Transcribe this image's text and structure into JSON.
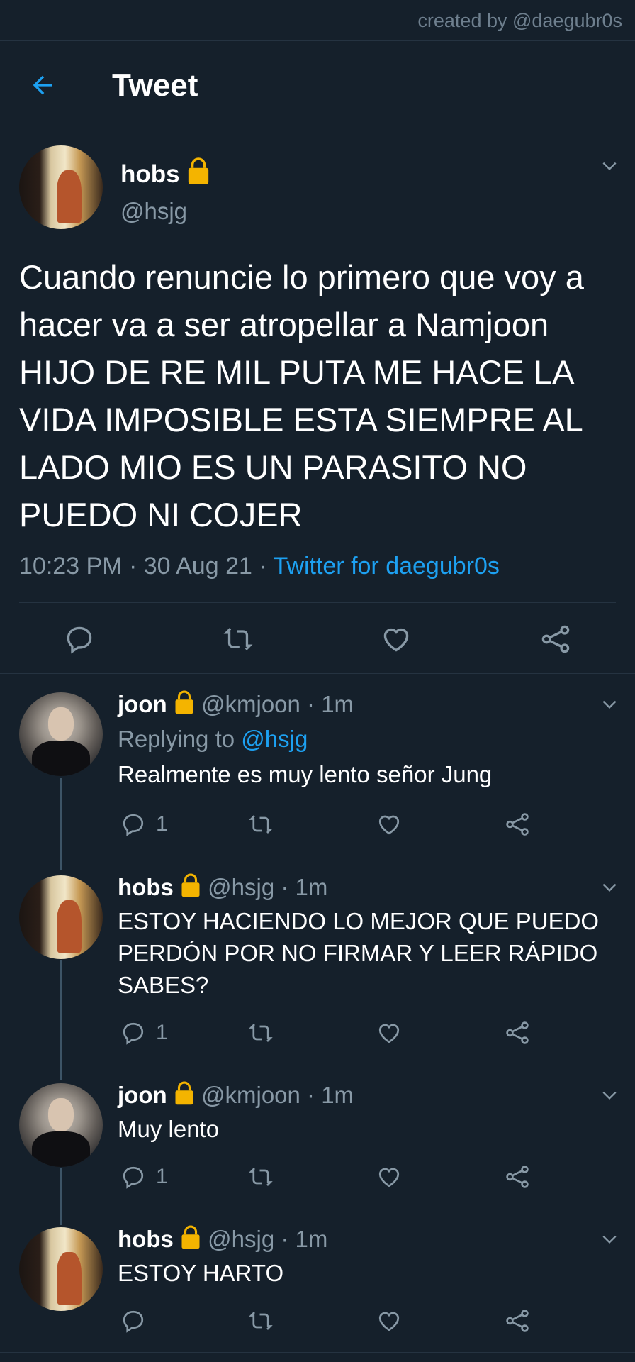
{
  "credit": "created by @daegubr0s",
  "header": {
    "title": "Tweet"
  },
  "main_tweet": {
    "name": "hobs",
    "handle": "@hsjg",
    "text": "Cuando renuncie lo primero que voy a hacer va a ser atropellar a Namjoon HIJO DE RE MIL PUTA ME HACE LA VIDA IMPOSIBLE ESTA SIEMPRE AL LADO MIO ES UN PARASITO NO PUEDO NI COJER",
    "time": "10:23 PM · 30 Aug 21 · ",
    "source": "Twitter for daegubr0s"
  },
  "replies": [
    {
      "name": "joon",
      "handle": "@kmjoon · 1m",
      "replying_prefix": "Replying to ",
      "replying_to": "@hsjg",
      "text": "Realmente es muy lento señor Jung",
      "reply_count": "1"
    },
    {
      "name": "hobs",
      "handle": "@hsjg · 1m",
      "text": "ESTOY HACIENDO LO MEJOR QUE PUEDO PERDÓN POR NO FIRMAR Y LEER RÁPIDO SABES?",
      "reply_count": "1"
    },
    {
      "name": "joon",
      "handle": "@kmjoon · 1m",
      "text": "Muy lento",
      "reply_count": "1"
    },
    {
      "name": "hobs",
      "handle": "@hsjg · 1m",
      "text": "ESTOY HARTO"
    }
  ],
  "colors": {
    "background": "#15202b",
    "accent": "#1da1f2",
    "muted": "#8899a6",
    "lock": "#f4b400"
  },
  "icons": [
    "back-arrow-icon",
    "chevron-down-icon",
    "reply-icon",
    "retweet-icon",
    "like-icon",
    "share-icon",
    "lock-icon"
  ]
}
